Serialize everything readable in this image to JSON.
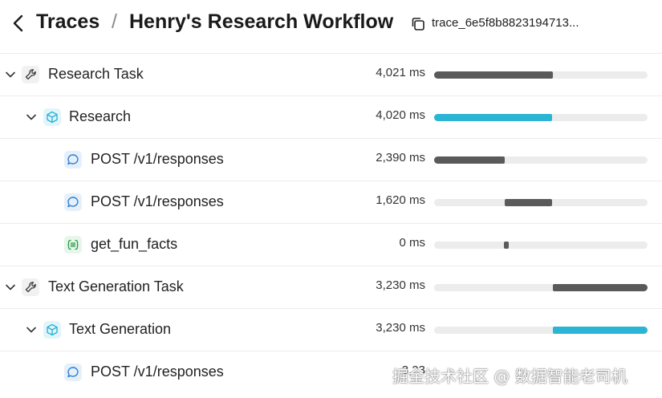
{
  "header": {
    "breadcrumb_root": "Traces",
    "separator": "/",
    "title": "Henry's Research Workflow",
    "trace_id": "trace_6e5f8b8823194713..."
  },
  "colors": {
    "bar": "#5a5a5a",
    "bar_accent": "#2bb4d3",
    "track": "#ececec"
  },
  "rows": [
    {
      "label": "Research Task",
      "duration": "4,021 ms",
      "icon": "wrench-icon",
      "expanded": true,
      "bar_start_ms": 0,
      "bar_length_ms": 4021,
      "accent": false
    },
    {
      "label": "Research",
      "duration": "4,020 ms",
      "icon": "cube-icon",
      "expanded": true,
      "bar_start_ms": 0,
      "bar_length_ms": 4020,
      "accent": true
    },
    {
      "label": "POST /v1/responses",
      "duration": "2,390 ms",
      "icon": "chat-bubble-icon",
      "expanded": false,
      "bar_start_ms": 0,
      "bar_length_ms": 2390,
      "accent": false
    },
    {
      "label": "POST /v1/responses",
      "duration": "1,620 ms",
      "icon": "chat-bubble-icon",
      "expanded": false,
      "bar_start_ms": 2390,
      "bar_length_ms": 1620,
      "accent": false
    },
    {
      "label": "get_fun_facts",
      "duration": "0 ms",
      "icon": "function-icon",
      "expanded": false,
      "bar_start_ms": 2390,
      "bar_length_ms": 0,
      "accent": false
    },
    {
      "label": "Text Generation Task",
      "duration": "3,230 ms",
      "icon": "wrench-icon",
      "expanded": true,
      "bar_start_ms": 4021,
      "bar_length_ms": 3230,
      "accent": false
    },
    {
      "label": "Text Generation",
      "duration": "3,230 ms",
      "icon": "cube-icon",
      "expanded": true,
      "bar_start_ms": 4021,
      "bar_length_ms": 3230,
      "accent": true
    },
    {
      "label": "POST /v1/responses",
      "duration": "3,23",
      "icon": "chat-bubble-icon",
      "expanded": false,
      "bar_start_ms": 4021,
      "bar_length_ms": 3230,
      "accent": false
    }
  ],
  "timeline_total_ms": 7251,
  "watermark": "掘金技术社区 @ 数据智能老司机"
}
